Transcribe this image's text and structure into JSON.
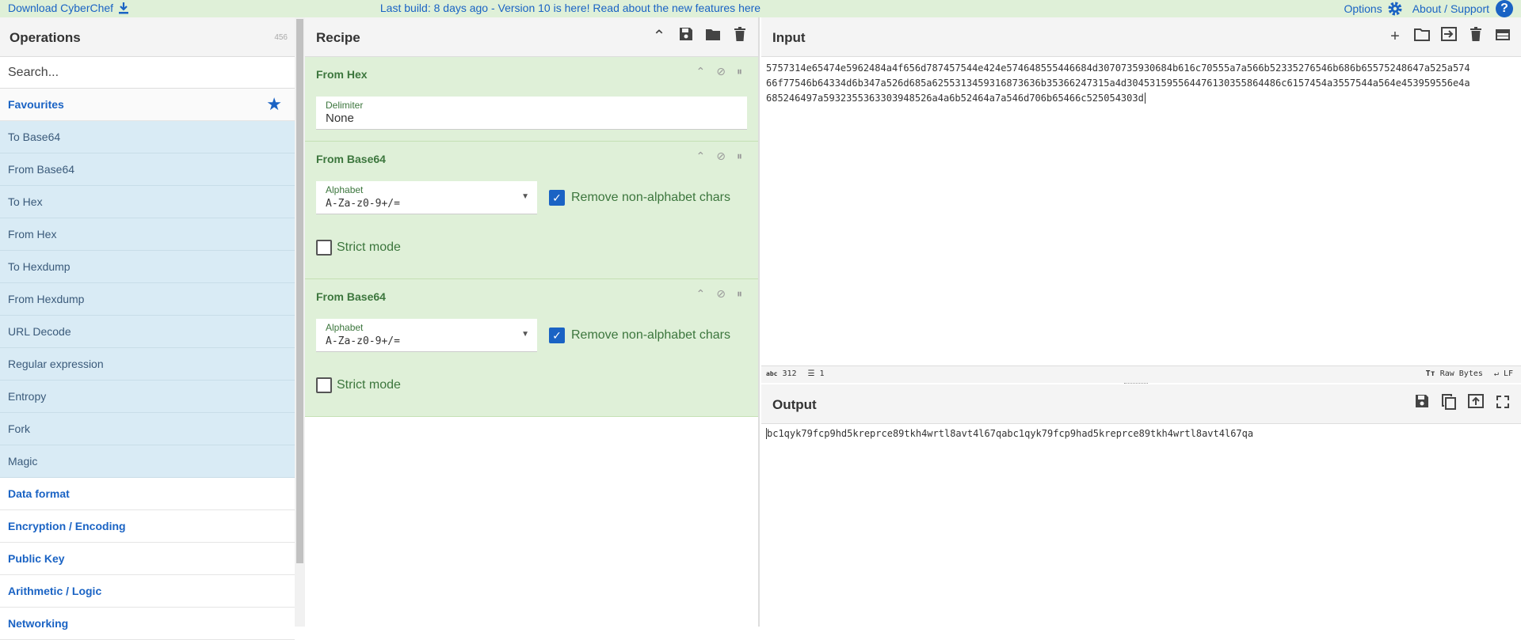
{
  "banner": {
    "download_label": "Download CyberChef",
    "download_icon": "download-icon",
    "center_text": "Last build: 8 days ago - Version 10 is here! Read about the new features here",
    "options_label": "Options",
    "options_icon": "gear-icon",
    "about_label": "About / Support",
    "help_icon": "help-icon"
  },
  "operations": {
    "title": "Operations",
    "count": "456",
    "search_placeholder": "Search...",
    "favourites_label": "Favourites",
    "favourites": [
      "To Base64",
      "From Base64",
      "To Hex",
      "From Hex",
      "To Hexdump",
      "From Hexdump",
      "URL Decode",
      "Regular expression",
      "Entropy",
      "Fork",
      "Magic"
    ],
    "categories": [
      "Data format",
      "Encryption / Encoding",
      "Public Key",
      "Arithmetic / Logic",
      "Networking"
    ]
  },
  "recipe": {
    "title": "Recipe",
    "steps": [
      {
        "name": "From Hex",
        "delimiter_label": "Delimiter",
        "delimiter_value": "None"
      },
      {
        "name": "From Base64",
        "alphabet_label": "Alphabet",
        "alphabet_value": "A-Za-z0-9+/=",
        "remove_label": "Remove non-alphabet chars",
        "remove_checked": true,
        "strict_label": "Strict mode",
        "strict_checked": false
      },
      {
        "name": "From Base64",
        "alphabet_label": "Alphabet",
        "alphabet_value": "A-Za-z0-9+/=",
        "remove_label": "Remove non-alphabet chars",
        "remove_checked": true,
        "strict_label": "Strict mode",
        "strict_checked": false
      }
    ]
  },
  "input": {
    "title": "Input",
    "text": "5757314e65474e5962484a4f656d787457544e424e574648555446684d3070735930684b616c70555a7a566b52335276546b686b65575248647a525a57466f77546b64334d6b347a526d685a625531345931687363 6b35366247315a4d304531595564476130355864486c6157454a3557544a564e453959556e4a685246497a5932355363303948526a4a6b52464a7a546d706b65466c525054303d",
    "line1": "5757314e65474e5962484a4f656d787457544e424e574648555446684d3070735930684b616c70555a7a566b52335276546b686b65575248647a525a574",
    "line2": "66f77546b64334d6b347a526d685a6255313459316873636b35366247315a4d304531595564476130355864486c6157454a3557544a564e453959556e4a",
    "line3": "685246497a5932355363303948526a4a6b52464a7a546d706b65466c525054303d",
    "length": "312",
    "lines": "1",
    "status_length_icon": "abc",
    "encoding": "Raw Bytes",
    "eol": "LF"
  },
  "output": {
    "title": "Output",
    "text": "bc1qyk79fcp9hd5kreprce89tkh4wrtl8avt4l67qabc1qyk79fcp9had5kreprce89tkh4wrtl8avt4l67qa"
  }
}
